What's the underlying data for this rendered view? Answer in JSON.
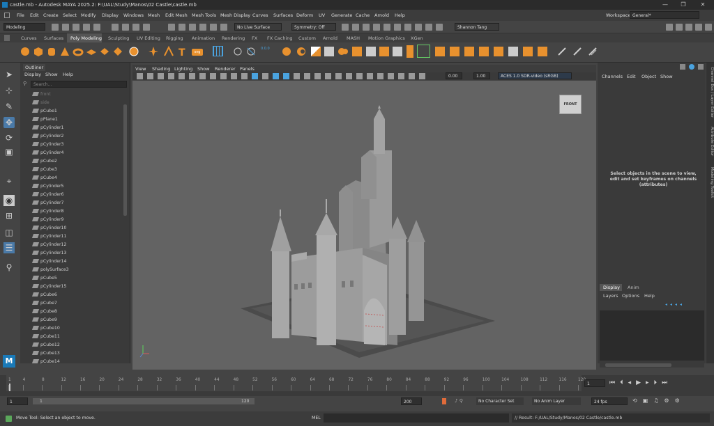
{
  "window": {
    "title": "castle.mb - Autodesk MAYA 2025.2: F:\\UAL\\Study\\Manos\\02 Castle\\castle.mb",
    "minimize": "—",
    "maximize": "❐",
    "close": "✕"
  },
  "menubar": [
    "File",
    "Edit",
    "Create",
    "Select",
    "Modify",
    "Display",
    "Windows",
    "Mesh",
    "Edit Mesh",
    "Mesh Tools",
    "Mesh Display",
    "Curves",
    "Surfaces",
    "Deform",
    "UV",
    "Generate",
    "Cache",
    "Arnold",
    "Help"
  ],
  "workspace": {
    "label": "Workspace:",
    "value": "General*"
  },
  "status_line": {
    "menuset": "Modeling",
    "live_surface": "No Live Surface",
    "symmetry": "Symmetry: Off",
    "user": "Shannon Tang"
  },
  "shelf_tabs": [
    "Curves",
    "Surfaces",
    "Poly Modeling",
    "Sculpting",
    "UV Editing",
    "Rigging",
    "Animation",
    "Rendering",
    "FX",
    "FX Caching",
    "Custom",
    "Arnold",
    "MASH",
    "Motion Graphics",
    "XGen"
  ],
  "shelf_active": "Poly Modeling",
  "outliner": {
    "title": "Outliner",
    "menu": [
      "Display",
      "Show",
      "Help"
    ],
    "search_placeholder": "Search...",
    "items": [
      "front",
      "side",
      "pCube1",
      "pPlane1",
      "pCylinder1",
      "pCylinder2",
      "pCylinder3",
      "pCylinder4",
      "pCube2",
      "pCube3",
      "pCube4",
      "pCylinder5",
      "pCylinder6",
      "pCylinder7",
      "pCylinder8",
      "pCylinder9",
      "pCylinder10",
      "pCylinder11",
      "pCylinder12",
      "pCylinder13",
      "pCylinder14",
      "polySurface3",
      "pCube5",
      "pCylinder15",
      "pCube6",
      "pCube7",
      "pCube8",
      "pCube9",
      "pCube10",
      "pCube11",
      "pCube12",
      "pCube13",
      "pCube14"
    ]
  },
  "viewport": {
    "menu": [
      "View",
      "Shading",
      "Lighting",
      "Show",
      "Renderer",
      "Panels"
    ],
    "exposure": "0.00",
    "gamma": "1.00",
    "color_space": "ACES 1.0 SDR-video (sRGB)",
    "viewcube_label": "FRONT",
    "bg_color": "#636363"
  },
  "channel_box": {
    "menu": [
      "Channels",
      "Edit",
      "Object",
      "Show"
    ],
    "message": "Select objects in the scene to view, edit and set keyframes on channels (attributes)"
  },
  "side_tabs": [
    "Channel Box / Layer Editor",
    "Attribute Editor",
    "Modeling Toolkit"
  ],
  "layer_editor": {
    "tabs": [
      "Display",
      "Anim"
    ],
    "menu": [
      "Layers",
      "Options",
      "Help"
    ]
  },
  "time_slider": {
    "ticks": [
      "1",
      "4",
      "8",
      "12",
      "16",
      "20",
      "24",
      "28",
      "32",
      "36",
      "40",
      "44",
      "48",
      "52",
      "56",
      "60",
      "64",
      "68",
      "72",
      "76",
      "80",
      "84",
      "88",
      "92",
      "96",
      "100",
      "104",
      "108",
      "112",
      "116",
      "120"
    ],
    "current_frame": "1"
  },
  "range_slider": {
    "start": "1",
    "inner_start": "1",
    "inner_end": "120",
    "end": "200",
    "character_set": "No Character Set",
    "anim_layer": "No Anim Layer",
    "fps": "24 fps"
  },
  "help_line": "Move Tool: Select an object to move.",
  "command_line": {
    "label": "MEL",
    "result": "// Result: F:/UAL/Study/Manos/02 Castle/castle.mb"
  },
  "accent_color": "#e8912e"
}
